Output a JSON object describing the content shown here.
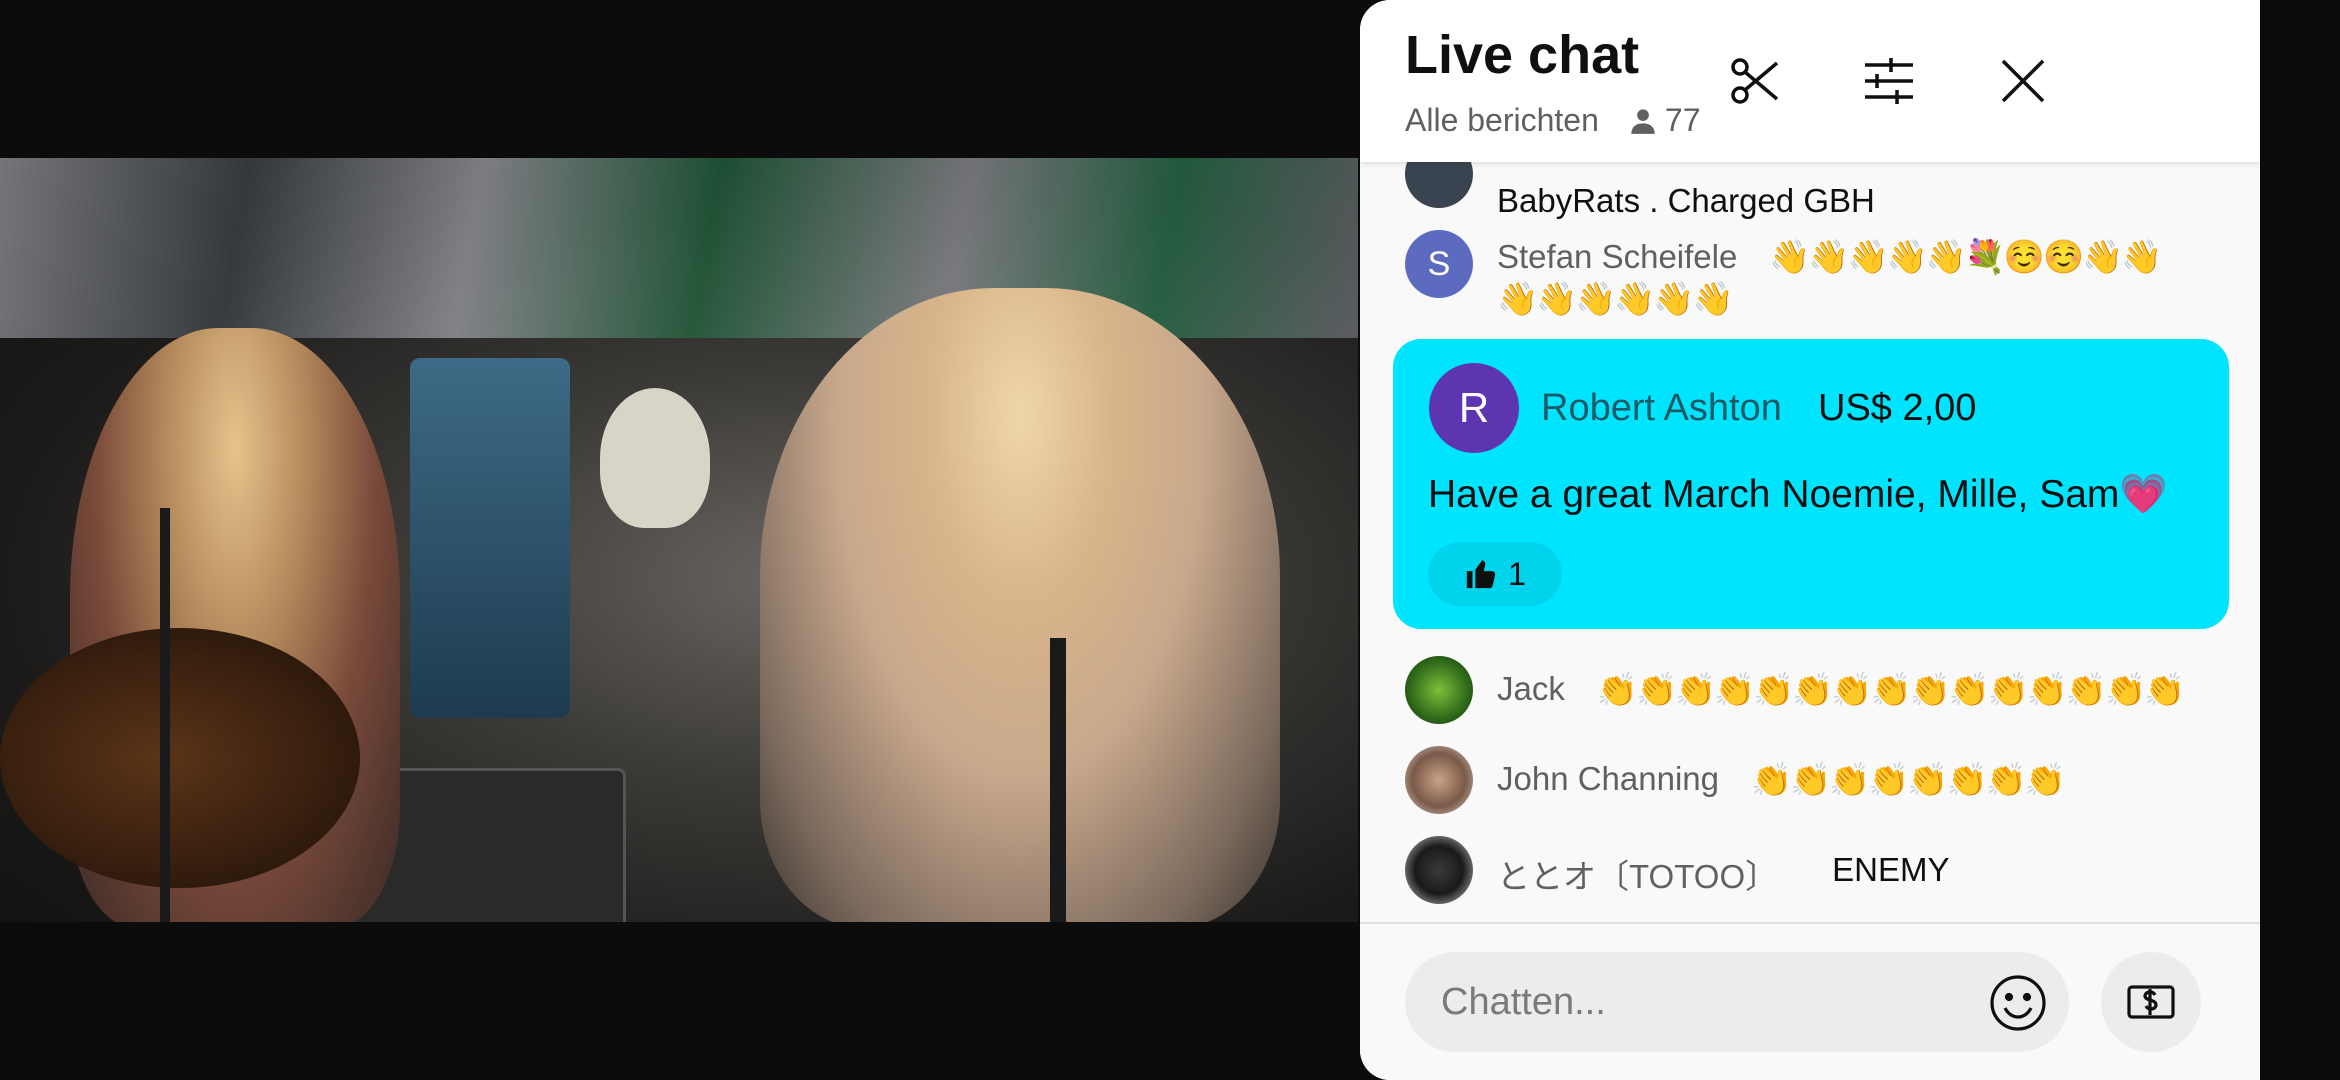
{
  "chat": {
    "title": "Live chat",
    "filter_label": "Alle berichten",
    "viewer_count": "77",
    "messages": [
      {
        "author": "",
        "text": "BabyRats . Charged GBH"
      },
      {
        "author": "Stefan Scheifele",
        "text": "👋👋👋👋👋💐☺️☺️👋👋",
        "text2": "👋👋👋👋👋👋",
        "initial": "S"
      },
      {
        "author": "Jack",
        "text": "👏👏👏👏👏👏👏👏👏👏👏👏👏👏👏"
      },
      {
        "author": "John Channing",
        "text": "👏👏👏👏👏👏👏👏"
      },
      {
        "author": "ととオ〔TOTOO〕",
        "text": "ENEMY"
      }
    ],
    "superchat": {
      "initial": "R",
      "author": "Robert Ashton",
      "amount": "US$ 2,00",
      "message": "Have a great March Noemie, Mille, Sam💗",
      "likes": "1"
    },
    "input_placeholder": "Chatten..."
  },
  "colors": {
    "superchat_bg": "#00e5ff",
    "superchat_avatar": "#5e35b1",
    "stefan_avatar": "#5c6bc0"
  },
  "icons": [
    "clip-icon",
    "filter-icon",
    "close-icon",
    "person-icon",
    "thumbs-up-icon",
    "emoji-icon",
    "super-chat-icon"
  ]
}
